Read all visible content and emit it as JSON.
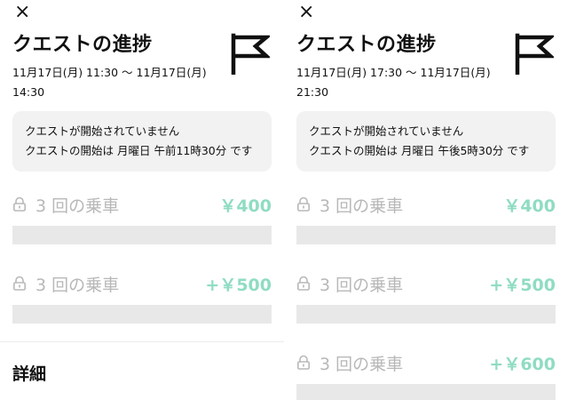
{
  "colors": {
    "reward": "#8fdcc3",
    "locked_text": "#b8b8b8",
    "bar": "#e8e8e8",
    "notice_bg": "#f2f2f2"
  },
  "left": {
    "close_icon": "×",
    "title": "クエストの進捗",
    "flag_icon": "flag-icon",
    "time_range_line1": "11月17日(月) 11:30 〜 11月17日(月)",
    "time_range_line2": "14:30",
    "notice": {
      "line1": "クエストが開始されていません",
      "line2": "クエストの開始は 月曜日 午前11時30分 です"
    },
    "quests": [
      {
        "label": "3 回の乗車",
        "reward": "￥400",
        "progress": 0
      },
      {
        "label": "3 回の乗車",
        "reward": "+￥500",
        "progress": 0
      }
    ],
    "details_label": "詳細"
  },
  "right": {
    "close_icon": "×",
    "title": "クエストの進捗",
    "flag_icon": "flag-icon",
    "time_range_line1": "11月17日(月) 17:30 〜 11月17日(月)",
    "time_range_line2": "21:30",
    "notice": {
      "line1": "クエストが開始されていません",
      "line2": "クエストの開始は 月曜日 午後5時30分 です"
    },
    "quests": [
      {
        "label": "3 回の乗車",
        "reward": "￥400",
        "progress": 0
      },
      {
        "label": "3 回の乗車",
        "reward": "+￥500",
        "progress": 0
      },
      {
        "label": "3 回の乗車",
        "reward": "+￥600",
        "progress": 0
      }
    ]
  }
}
